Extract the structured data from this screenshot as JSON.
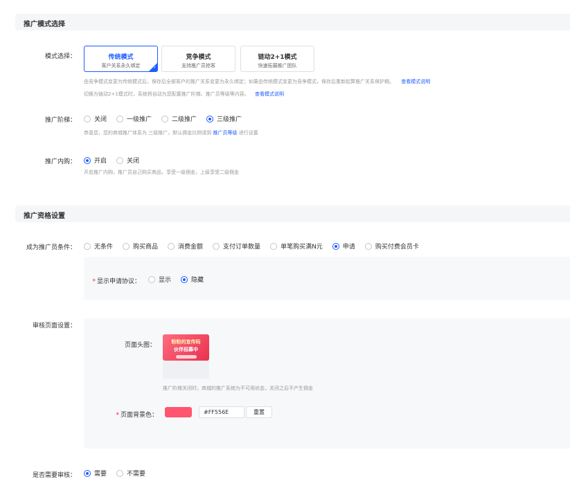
{
  "section1": {
    "title": "推广模式选择",
    "mode_label": "模式选择：",
    "modes": [
      {
        "title": "传统模式",
        "sub": "客户关系永久绑定",
        "active": true
      },
      {
        "title": "竞争模式",
        "sub": "支持推广员抢客",
        "active": false
      },
      {
        "title": "链动2+1模式",
        "sub": "快速拓展推广团队",
        "active": false
      }
    ],
    "mode_hint1": "由竞争模式变更为传统模式后，保存后全部客户的推广关系变更为永久绑定；如果由传统模式变更为竞争模式，保存后重新起算推广关系保护期。",
    "mode_hint1_link": "查看模式说明",
    "mode_hint2": "切换为链动2+1模式时，系统将自动为您配置推广阶梯、推广员等级等内容。",
    "mode_hint2_link": "查看模式说明",
    "level_label": "推广阶梯：",
    "levels": [
      "关闭",
      "一级推广",
      "二级推广",
      "三级推广"
    ],
    "level_checked": 3,
    "level_hint": "恭喜您，您的商城推广体系为 三级推广，默认佣金比例请到",
    "level_hint_link": "推广员等级",
    "level_hint_tail": "进行设置",
    "inner_label": "推广内购：",
    "inner_options": [
      "开启",
      "关闭"
    ],
    "inner_checked": 0,
    "inner_hint": "开启推广内购，推广员自己购买商品，享受一级佣金，上级享受二级佣金"
  },
  "section2": {
    "title": "推广资格设置",
    "cond_label": "成为推广员条件：",
    "conditions": [
      "无条件",
      "购买商品",
      "消费金额",
      "支付订单数量",
      "单笔购买满N元",
      "申请",
      "购买付费会员卡"
    ],
    "cond_checked": 5,
    "agreement_label": "显示申请协议：",
    "agreement_options": [
      "显示",
      "隐藏"
    ],
    "agreement_checked": 1,
    "audit_page_label": "审核页面设置：",
    "header_img_label": "页面头图：",
    "banner_line1": "粉粉的宣传码",
    "banner_line2": "伙伴招募中",
    "header_hint": "推广阶梯关闭时，商城的推广系统为不可用状态，关闭之后不产生佣金",
    "bg_color_label": "页面背景色：",
    "bg_color_value": "#FF556E",
    "bg_color": "#FF556E",
    "reset_label": "重置",
    "need_audit_label": "是否需要审核：",
    "audit_options": [
      "需要",
      "不需要"
    ],
    "audit_checked": 0
  },
  "colors": {
    "primary": "#1b5cff",
    "required": "#f5222d",
    "hint": "#999999"
  }
}
